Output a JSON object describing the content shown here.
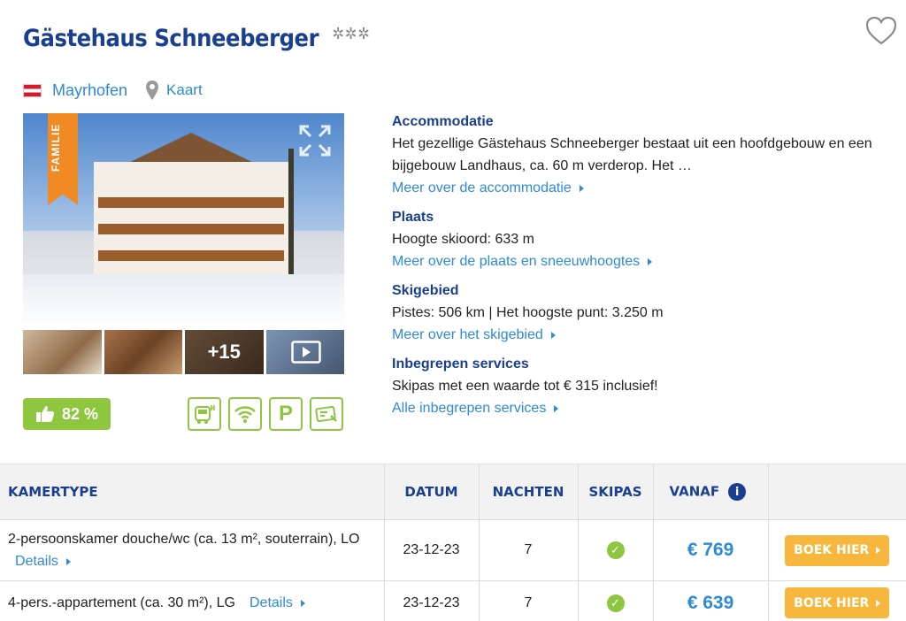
{
  "hotel": {
    "name": "Gästehaus Schneeberger",
    "stars": "✲✲✲",
    "location": "Mayrhofen",
    "map_label": "Kaart",
    "badge": "FAMILIE",
    "more_photos": "+15",
    "rating": "82 %"
  },
  "info": {
    "accommodation_title": "Accommodatie",
    "accommodation_text": "Het gezellige Gästehaus Schneeberger bestaat uit een hoofdgebouw en een bijgebouw Landhaus, ca. 60 m verderop. Het …",
    "accommodation_more": "Meer over de accommodatie",
    "place_title": "Plaats",
    "place_text": "Hoogte skioord: 633 m",
    "place_more": "Meer over de plaats en sneeuwhoogtes",
    "ski_title": "Skigebied",
    "ski_text": "Pistes: 506 km | Het hoogste punt: 3.250 m",
    "ski_more": "Meer over het skigebied",
    "services_title": "Inbegrepen services",
    "services_text": "Skipas met een waarde tot € 315 inclusief!",
    "services_more": "Alle inbegrepen services"
  },
  "table": {
    "headers": {
      "roomtype": "KAMERTYPE",
      "date": "DATUM",
      "nights": "NACHTEN",
      "skipass": "SKIPAS",
      "from": "VANAF",
      "info_icon": "i"
    },
    "rows": [
      {
        "room": "2-persoonskamer douche/wc (ca. 13 m², souterrain), LO",
        "details": "Details",
        "date": "23-12-23",
        "nights": "7",
        "price": "€ 769",
        "book": "BOEK HIER"
      },
      {
        "room": "4-pers.-appartement (ca. 30 m²), LG",
        "details": "Details",
        "date": "23-12-23",
        "nights": "7",
        "price": "€ 639",
        "book": "BOEK HIER"
      }
    ]
  },
  "colors": {
    "title": "#1b3f8f",
    "link": "#2d8ad6",
    "green": "#8ec63f",
    "book": "#f6b73c",
    "ribbon": "#f08a24"
  }
}
